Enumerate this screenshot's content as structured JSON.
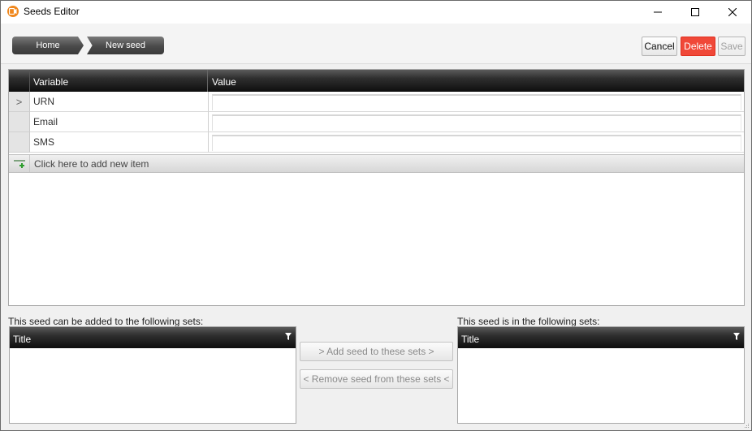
{
  "window": {
    "title": "Seeds Editor",
    "minimize_label": "minimize",
    "maximize_label": "maximize",
    "close_label": "close"
  },
  "breadcrumb": {
    "home": "Home",
    "current": "New seed"
  },
  "toolbar": {
    "cancel": "Cancel",
    "delete": "Delete",
    "save": "Save"
  },
  "grid": {
    "columns": [
      "Variable",
      "Value"
    ],
    "rows": [
      {
        "indicator": ">",
        "variable": "URN",
        "value": ""
      },
      {
        "indicator": "",
        "variable": "Email",
        "value": ""
      },
      {
        "indicator": "",
        "variable": "SMS",
        "value": ""
      }
    ],
    "add_new_item": "Click here to add new item"
  },
  "available_sets": {
    "label": "This seed can be added to the following sets:",
    "column": "Title"
  },
  "member_sets": {
    "label": "This seed is in the following sets:",
    "column": "Title"
  },
  "actions": {
    "add_to_sets": "> Add seed to these sets >",
    "remove_from_sets": "< Remove seed from these sets <"
  },
  "colors": {
    "app_icon": "#f0881e",
    "delete_button": "#f04838",
    "header_dark": "#0e0e0e"
  }
}
